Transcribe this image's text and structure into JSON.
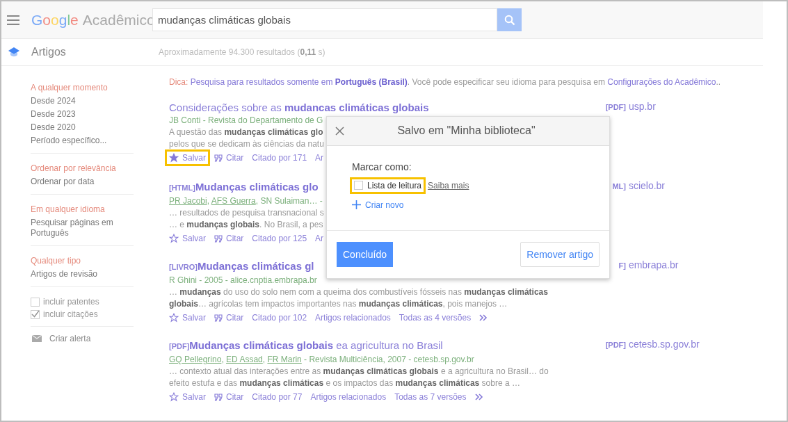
{
  "header": {
    "logo": {
      "brand": [
        {
          "letter": "G",
          "color": "#7baaf7"
        },
        {
          "letter": "o",
          "color": "#f28b82"
        },
        {
          "letter": "o",
          "color": "#fdd663"
        },
        {
          "letter": "g",
          "color": "#7baaf7"
        },
        {
          "letter": "l",
          "color": "#81c995"
        },
        {
          "letter": "e",
          "color": "#f28b82"
        }
      ],
      "product": "Acadêmico"
    },
    "search": {
      "value": "mudanças climáticas globais"
    }
  },
  "subheader": {
    "section": "Artigos",
    "stats": "Aproximadamente 94.300 resultados (**0,11** s)"
  },
  "sidebar": {
    "groups": [
      {
        "items": [
          {
            "label": "A qualquer momento",
            "selected": true
          },
          {
            "label": "Desde 2024",
            "selected": false
          },
          {
            "label": "Desde 2023",
            "selected": false
          },
          {
            "label": "Desde 2020",
            "selected": false
          },
          {
            "label": "Período específico...",
            "selected": false
          }
        ]
      },
      {
        "items": [
          {
            "label": "Ordenar por relevância",
            "selected": true
          },
          {
            "label": "Ordenar por data",
            "selected": false
          }
        ]
      },
      {
        "items": [
          {
            "label": "Em qualquer idioma",
            "selected": true
          },
          {
            "label": "Pesquisar páginas em Português",
            "selected": false
          }
        ]
      },
      {
        "items": [
          {
            "label": "Qualquer tipo",
            "selected": true
          },
          {
            "label": "Artigos de revisão",
            "selected": false
          }
        ]
      }
    ],
    "checkboxes": [
      {
        "label": "incluir patentes",
        "checked": false
      },
      {
        "label": "incluir citações",
        "checked": true
      }
    ],
    "alert": "Criar alerta"
  },
  "tip": {
    "label": "Dica:",
    "parts": [
      {
        "kind": "link",
        "text": "Pesquisa para resultados somente em **Português (Brasil)**"
      },
      {
        "kind": "text",
        "text": ". Você pode especificar seu idioma para pesquisa em "
      },
      {
        "kind": "link",
        "text": "Configurações do Acadêmico"
      },
      {
        "kind": "text",
        "text": ".."
      }
    ]
  },
  "results": [
    {
      "title": "Considerações sobre as **mudancas climáticas globais**",
      "source": {
        "format": "[PDF]",
        "domain": "usp.br"
      },
      "byline": [
        {
          "text": "JB Conti - Revista do Departamento de G",
          "linked": false
        }
      ],
      "snippet": [
        "A questão das **mudanças climáticas glo**",
        "pelos que se dedicam às ciências da natu"
      ],
      "actions": [
        {
          "kind": "save",
          "text": "Salvar",
          "starred": true,
          "highlighted": true
        },
        {
          "kind": "cite",
          "text": "Citar"
        },
        {
          "kind": "link",
          "text": "Citado por 171"
        },
        {
          "kind": "link",
          "text": "Ar"
        }
      ]
    },
    {
      "format": "[HTML]",
      "title": "**Mudanças climáticas glo**",
      "source": {
        "format": "ML]",
        "domain": "scielo.br"
      },
      "byline": [
        {
          "text": "PR Jacobi",
          "linked": true
        },
        {
          "text": ", ",
          "linked": false
        },
        {
          "text": "AFS Guerra",
          "linked": true
        },
        {
          "text": ", SN Sulaiman… -",
          "linked": false
        }
      ],
      "snippet": [
        "… resultados de pesquisa transnacional s",
        "… e **mudanças globais**. No Brasil, a pes"
      ],
      "actions": [
        {
          "kind": "save",
          "text": "Salvar",
          "starred": false,
          "highlighted": false
        },
        {
          "kind": "cite",
          "text": "Citar"
        },
        {
          "kind": "link",
          "text": "Citado por 125"
        },
        {
          "kind": "link",
          "text": "Ar"
        }
      ]
    },
    {
      "format": "[LIVRO]",
      "title": "**Mudanças climáticas gl**",
      "source": {
        "format": "F]",
        "domain": "embrapa.br"
      },
      "byline": [
        {
          "text": "R Ghini - 2005 - alice.cnptia.embrapa.br",
          "linked": false
        }
      ],
      "snippet": [
        "… **mudanças** do uso do solo nem com a queima dos combustíveis fósseis nas **mudanças climáticas globais**… agrícolas tem impactos importantes nas **mudanças climáticas**, pois manejos …"
      ],
      "actions": [
        {
          "kind": "save",
          "text": "Salvar",
          "starred": false,
          "highlighted": false
        },
        {
          "kind": "cite",
          "text": "Citar"
        },
        {
          "kind": "link",
          "text": "Citado por 102"
        },
        {
          "kind": "link",
          "text": "Artigos relacionados"
        },
        {
          "kind": "link",
          "text": "Todas as 4 versões"
        },
        {
          "kind": "more"
        }
      ]
    },
    {
      "format": "[PDF]",
      "title": "**Mudanças climáticas globais** ea agricultura no Brasil",
      "source": {
        "format": "[PDF]",
        "domain": "cetesb.sp.gov.br"
      },
      "byline": [
        {
          "text": "GQ Pellegrino",
          "linked": true
        },
        {
          "text": ", ",
          "linked": false
        },
        {
          "text": "ED Assad",
          "linked": true
        },
        {
          "text": ", ",
          "linked": false
        },
        {
          "text": "FR Marin",
          "linked": true
        },
        {
          "text": " - Revista Multiciência, 2007 - cetesb.sp.gov.br",
          "linked": false
        }
      ],
      "snippet": [
        "… contexto atual das interações entre as **mudanças climáticas globais** e a agricultura no Brasil… do efeito estufa e das **mudanças climáticas** e os impactos das **mudanças climáticas** sobre a …"
      ],
      "actions": [
        {
          "kind": "save",
          "text": "Salvar",
          "starred": false,
          "highlighted": false
        },
        {
          "kind": "cite",
          "text": "Citar"
        },
        {
          "kind": "link",
          "text": "Citado por 77"
        },
        {
          "kind": "link",
          "text": "Artigos relacionados"
        },
        {
          "kind": "link",
          "text": "Todas as 7 versões"
        },
        {
          "kind": "more"
        }
      ]
    }
  ],
  "dialog": {
    "title": "Salvo em \"Minha biblioteca\"",
    "prompt": "Marcar como:",
    "labels": [
      {
        "text": "Lista de leitura",
        "checked": false,
        "highlighted": true
      }
    ],
    "learn_more": "Saiba mais",
    "create": "Criar novo",
    "done": "Concluído",
    "remove": "Remover artigo"
  }
}
